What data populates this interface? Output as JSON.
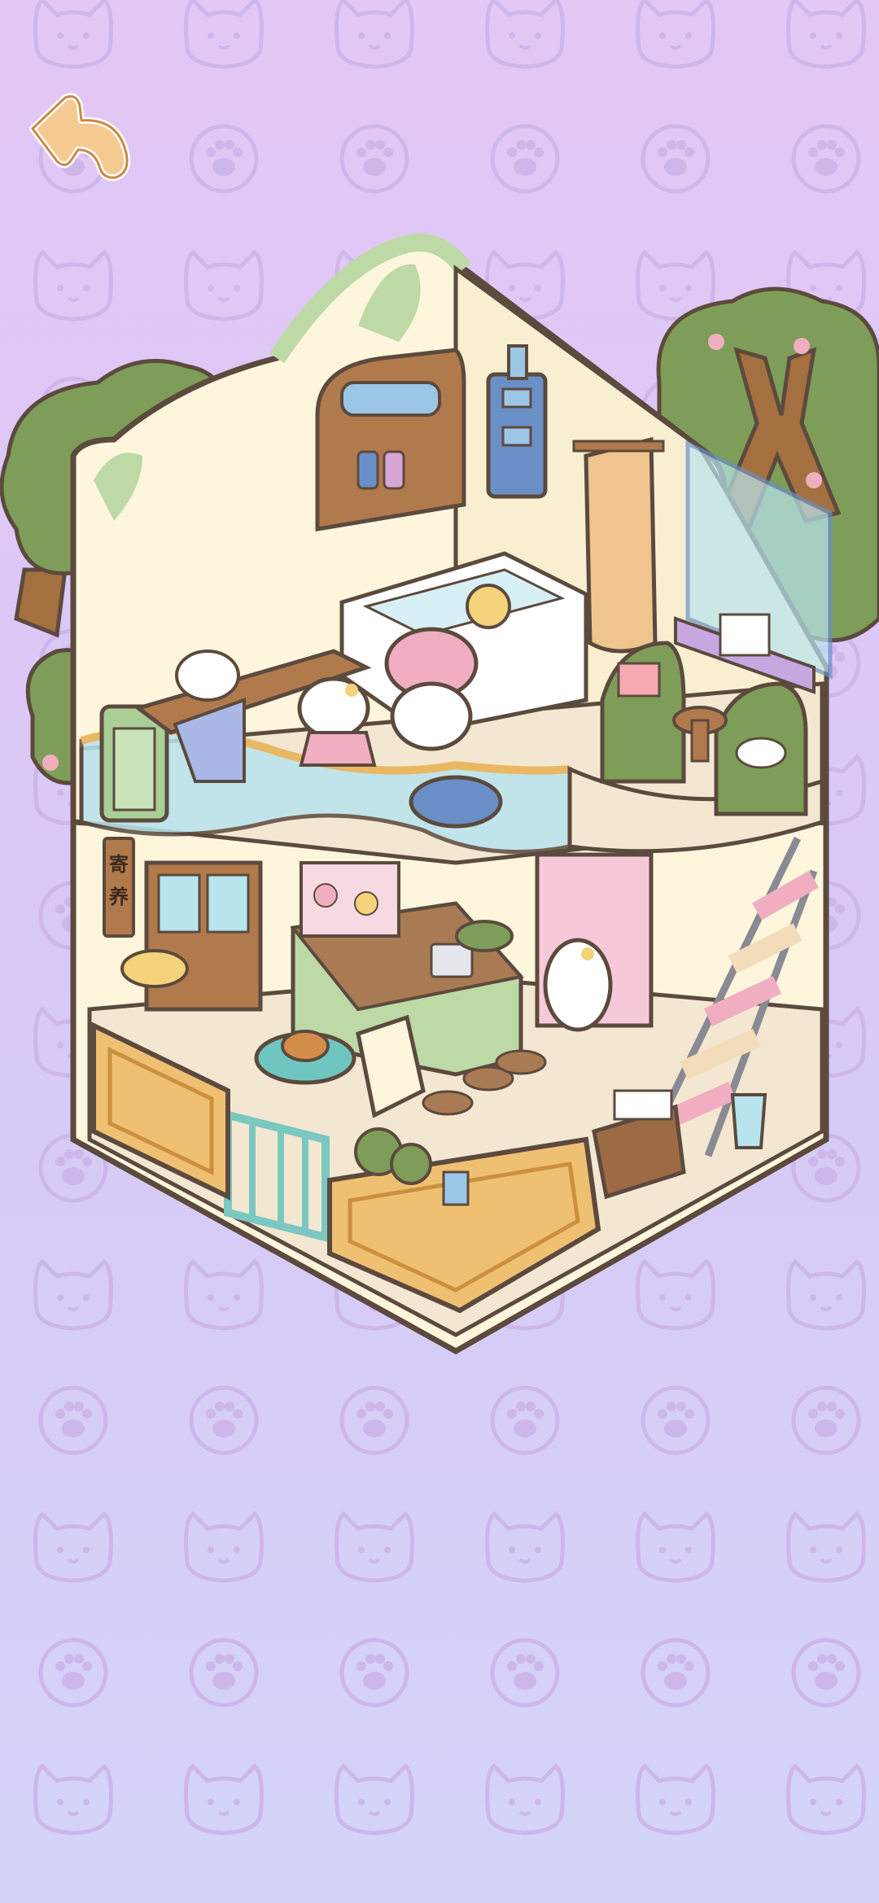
{
  "app": {
    "back_button": {
      "icon": "back-arrow-icon"
    }
  },
  "scene": {
    "title": "",
    "sign_text": "寄养",
    "colors": {
      "background_top": "#e3c7f5",
      "background_bottom": "#d4d4f8",
      "pattern": "#cdb6ea",
      "frame": "#5c4a3e",
      "wall_cream": "#fdf6dc",
      "roof_green": "#bcd9a6",
      "tree_green": "#7e9d58",
      "trunk": "#a4703f",
      "wood": "#b07a4c",
      "floor": "#f3e7d2",
      "glass": "#b8e4ee",
      "counter_orange": "#f0c072",
      "cat_pink": "#f1aec1"
    },
    "background_icons": [
      "cat-face-icon",
      "paw-print-icon"
    ]
  }
}
